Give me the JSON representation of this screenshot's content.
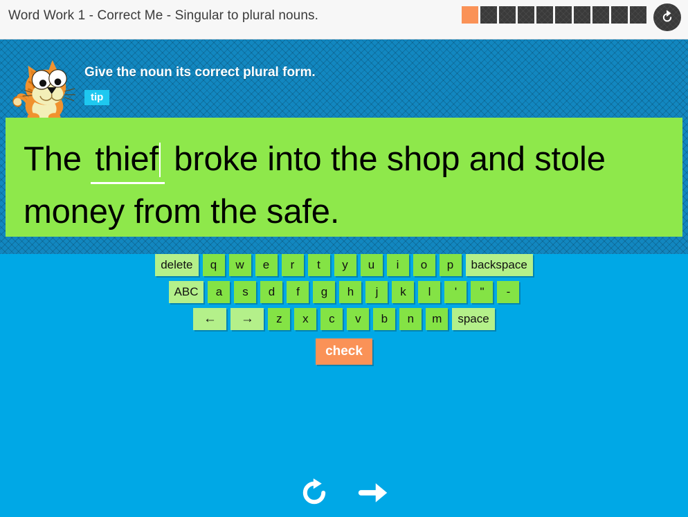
{
  "header": {
    "title": "Word Work 1 - Correct Me - Singular to plural nouns.",
    "refresh_icon": "refresh-icon",
    "progress": {
      "total": 10,
      "completed": 1,
      "done_color": "#fa9257",
      "pending_color": "#3a3a3a"
    }
  },
  "stage": {
    "mascot_icon": "cat-mascot-icon",
    "prompt": "Give the noun its correct plural form.",
    "tip_label": "tip",
    "tip_color": "#1ec8f0",
    "background_color": "#1287c0"
  },
  "sentence": {
    "panel_color": "#8ee84b",
    "before": "The ",
    "blank_value": "thief",
    "after": " broke into the shop and stole money from the safe.",
    "full_text": "The thief broke into the shop and stole money from the safe."
  },
  "keyboard": {
    "rows": [
      [
        {
          "label": "delete",
          "type": "wide"
        },
        {
          "label": "q",
          "type": "letter"
        },
        {
          "label": "w",
          "type": "letter"
        },
        {
          "label": "e",
          "type": "letter"
        },
        {
          "label": "r",
          "type": "letter"
        },
        {
          "label": "t",
          "type": "letter"
        },
        {
          "label": "y",
          "type": "letter"
        },
        {
          "label": "u",
          "type": "letter"
        },
        {
          "label": "i",
          "type": "letter"
        },
        {
          "label": "o",
          "type": "letter"
        },
        {
          "label": "p",
          "type": "letter"
        },
        {
          "label": "backspace",
          "type": "wide"
        }
      ],
      [
        {
          "label": "ABC",
          "type": "wide"
        },
        {
          "label": "a",
          "type": "letter"
        },
        {
          "label": "s",
          "type": "letter"
        },
        {
          "label": "d",
          "type": "letter"
        },
        {
          "label": "f",
          "type": "letter"
        },
        {
          "label": "g",
          "type": "letter"
        },
        {
          "label": "h",
          "type": "letter"
        },
        {
          "label": "j",
          "type": "letter"
        },
        {
          "label": "k",
          "type": "letter"
        },
        {
          "label": "l",
          "type": "letter"
        },
        {
          "label": "'",
          "type": "letter"
        },
        {
          "label": "\"",
          "type": "letter"
        },
        {
          "label": "-",
          "type": "letter"
        }
      ],
      [
        {
          "label": "←",
          "type": "arrow"
        },
        {
          "label": "→",
          "type": "arrow"
        },
        {
          "label": "z",
          "type": "letter"
        },
        {
          "label": "x",
          "type": "letter"
        },
        {
          "label": "c",
          "type": "letter"
        },
        {
          "label": "v",
          "type": "letter"
        },
        {
          "label": "b",
          "type": "letter"
        },
        {
          "label": "n",
          "type": "letter"
        },
        {
          "label": "m",
          "type": "letter"
        },
        {
          "label": "space",
          "type": "wide"
        }
      ]
    ],
    "check_label": "check",
    "key_color": "#84e345",
    "special_key_color": "#b4f08a",
    "check_color": "#fa9257"
  },
  "bottom_nav": {
    "replay_icon": "replay-icon",
    "next_icon": "arrow-right-icon",
    "background_color": "#00a8e6"
  }
}
